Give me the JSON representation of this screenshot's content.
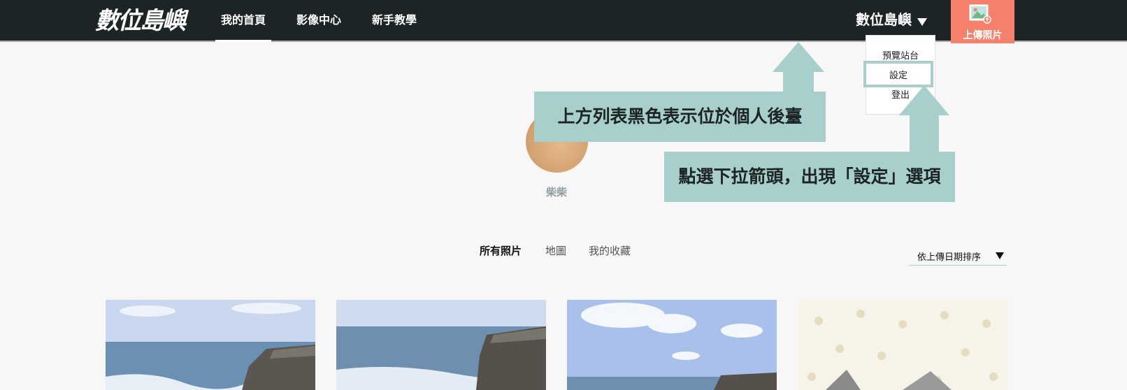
{
  "header": {
    "logo": "數位島嶼",
    "nav": [
      {
        "label": "我的首頁",
        "active": true
      },
      {
        "label": "影像中心",
        "active": false
      },
      {
        "label": "新手教學",
        "active": false
      }
    ],
    "user_name": "數位島嶼",
    "upload_label": "上傳照片"
  },
  "dropdown": {
    "items": [
      "預覽站台",
      "設定",
      "登出"
    ],
    "highlighted": "設定"
  },
  "annotations": {
    "callout_top": "上方列表黑色表示位於個人後臺",
    "callout_bottom": "點選下拉箭頭，出現「設定」選項"
  },
  "profile": {
    "name": "柴柴"
  },
  "content_tabs": [
    {
      "label": "所有照片",
      "active": true
    },
    {
      "label": "地圖",
      "active": false
    },
    {
      "label": "我的收藏",
      "active": false
    }
  ],
  "sort": {
    "label": "依上傳日期排序"
  },
  "colors": {
    "topbar": "#1d2426",
    "accent_upload": "#f5806b",
    "annotation": "#a8cfcb",
    "background": "#f7f7f7"
  }
}
